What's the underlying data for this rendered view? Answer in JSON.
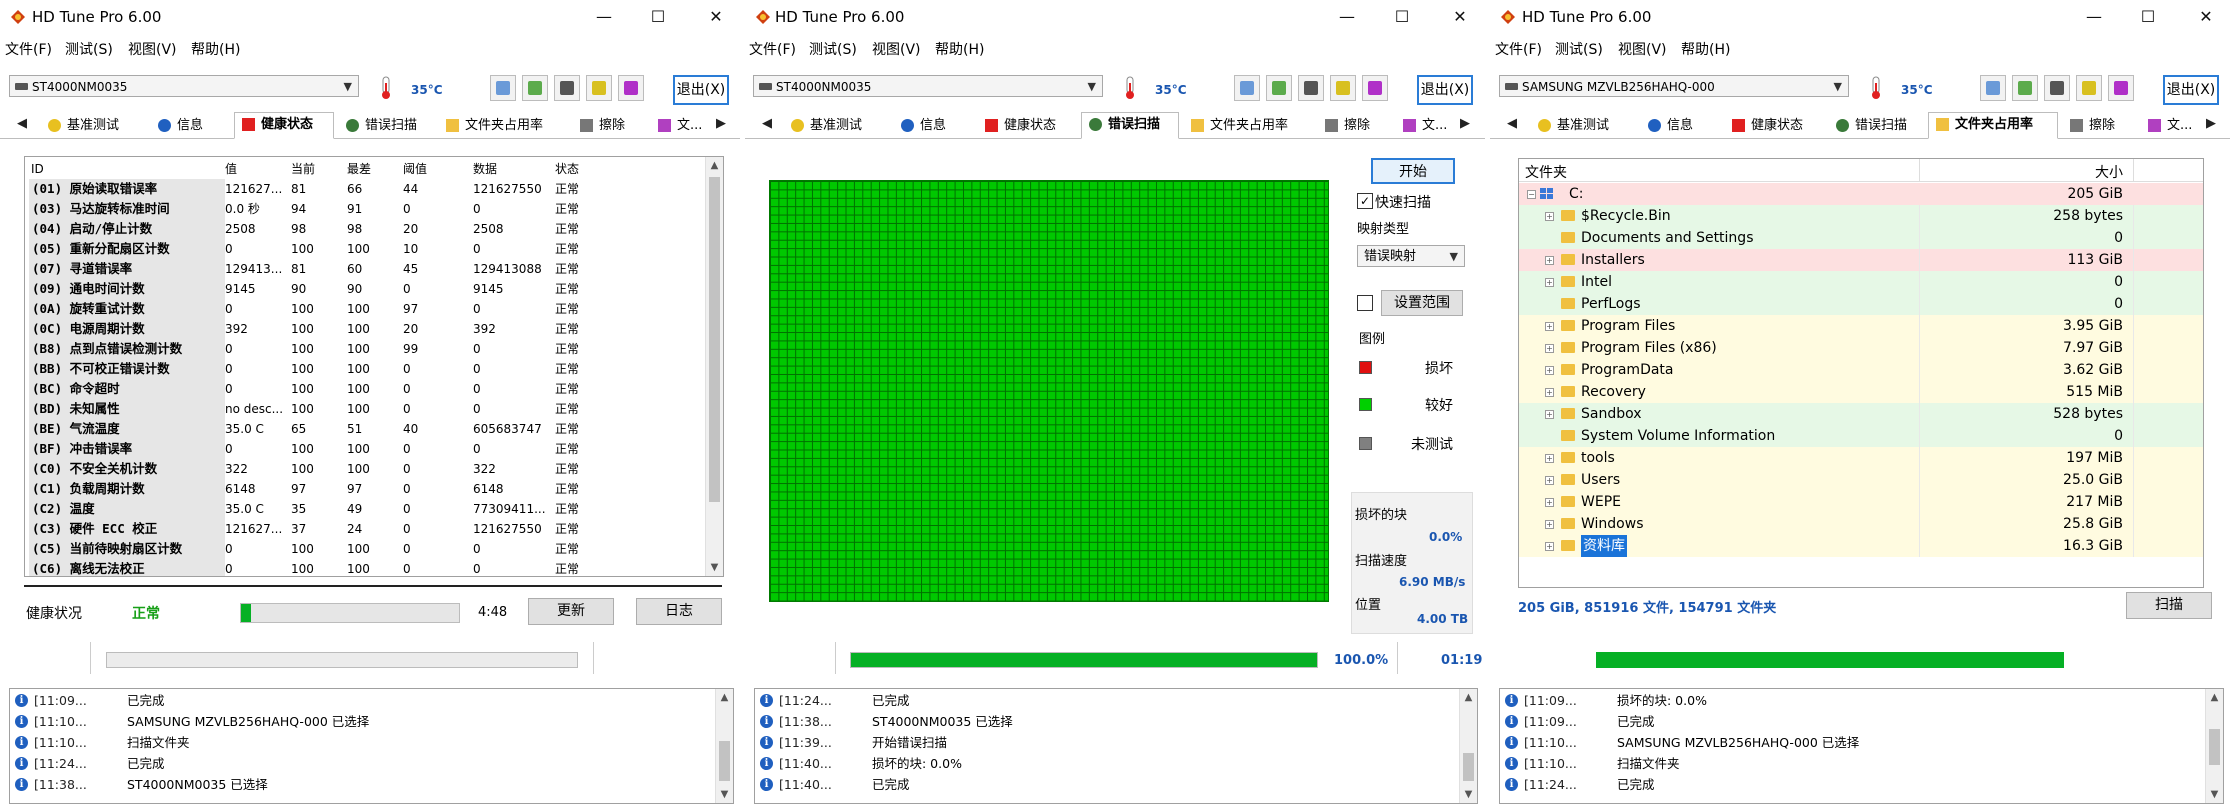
{
  "app": {
    "title": "HD Tune Pro 6.00",
    "exit_label": "退出(X)",
    "temp": "35°C"
  },
  "menu": [
    "文件(F)",
    "测试(S)",
    "视图(V)",
    "帮助(H)"
  ],
  "tabs": [
    "基准测试",
    "信息",
    "健康状态",
    "错误扫描",
    "文件夹占用率",
    "擦除",
    "文..."
  ],
  "win1": {
    "drive": "ST4000NM0035",
    "columns": [
      "ID",
      "值",
      "当前",
      "最差",
      "阈值",
      "数据",
      "状态"
    ],
    "rows": [
      [
        "(01) 原始读取错误率",
        "121627...",
        "81",
        "66",
        "44",
        "121627550",
        "正常"
      ],
      [
        "(03) 马达旋转标准时间",
        "0.0 秒",
        "94",
        "91",
        "0",
        "0",
        "正常"
      ],
      [
        "(04) 启动/停止计数",
        "2508",
        "98",
        "98",
        "20",
        "2508",
        "正常"
      ],
      [
        "(05) 重新分配扇区计数",
        "0",
        "100",
        "100",
        "10",
        "0",
        "正常"
      ],
      [
        "(07) 寻道错误率",
        "129413...",
        "81",
        "60",
        "45",
        "129413088",
        "正常"
      ],
      [
        "(09) 通电时间计数",
        "9145",
        "90",
        "90",
        "0",
        "9145",
        "正常"
      ],
      [
        "(0A) 旋转重试计数",
        "0",
        "100",
        "100",
        "97",
        "0",
        "正常"
      ],
      [
        "(0C) 电源周期计数",
        "392",
        "100",
        "100",
        "20",
        "392",
        "正常"
      ],
      [
        "(B8) 点到点错误检测计数",
        "0",
        "100",
        "100",
        "99",
        "0",
        "正常"
      ],
      [
        "(BB) 不可校正错误计数",
        "0",
        "100",
        "100",
        "0",
        "0",
        "正常"
      ],
      [
        "(BC) 命令超时",
        "0",
        "100",
        "100",
        "0",
        "0",
        "正常"
      ],
      [
        "(BD) 未知属性",
        "no desc...",
        "100",
        "100",
        "0",
        "0",
        "正常"
      ],
      [
        "(BE) 气流温度",
        "35.0 C",
        "65",
        "51",
        "40",
        "605683747",
        "正常"
      ],
      [
        "(BF) 冲击错误率",
        "0",
        "100",
        "100",
        "0",
        "0",
        "正常"
      ],
      [
        "(C0) 不安全关机计数",
        "322",
        "100",
        "100",
        "0",
        "322",
        "正常"
      ],
      [
        "(C1) 负载周期计数",
        "6148",
        "97",
        "97",
        "0",
        "6148",
        "正常"
      ],
      [
        "(C2) 温度",
        "35.0 C",
        "35",
        "49",
        "0",
        "77309411...",
        "正常"
      ],
      [
        "(C3) 硬件 ECC 校正",
        "121627...",
        "37",
        "24",
        "0",
        "121627550",
        "正常"
      ],
      [
        "(C5) 当前待映射扇区计数",
        "0",
        "100",
        "100",
        "0",
        "0",
        "正常"
      ],
      [
        "(C6) 离线无法校正",
        "0",
        "100",
        "100",
        "0",
        "0",
        "正常"
      ]
    ],
    "health_label": "健康状况",
    "health_value": "正常",
    "time": "4:48",
    "update_label": "更新",
    "log_label": "日志",
    "log": [
      [
        "[11:09...",
        "已完成"
      ],
      [
        "[11:10...",
        "SAMSUNG MZVLB256HAHQ-000 已选择"
      ],
      [
        "[11:10...",
        "扫描文件夹"
      ],
      [
        "[11:24...",
        "已完成"
      ],
      [
        "[11:38...",
        "ST4000NM0035 已选择"
      ]
    ]
  },
  "win2": {
    "drive": "ST4000NM0035",
    "start_label": "开始",
    "quick_scan_label": "快速扫描",
    "map_type_label": "映射类型",
    "map_type_value": "错误映射",
    "range_label": "设置范围",
    "legend_title": "图例",
    "legend": [
      {
        "label": "损坏",
        "color": "#e01010"
      },
      {
        "label": "较好",
        "color": "#00d000"
      },
      {
        "label": "未测试",
        "color": "#808080"
      }
    ],
    "bad_blocks_label": "损坏的块",
    "bad_blocks_value": "0.0%",
    "speed_label": "扫描速度",
    "speed_value": "6.90 MB/s",
    "position_label": "位置",
    "position_value": "4.00 TB",
    "progress": 1.0,
    "progress_text": "100.0%",
    "elapsed": "01:19",
    "log": [
      [
        "[11:24...",
        "已完成"
      ],
      [
        "[11:38...",
        "ST4000NM0035 已选择"
      ],
      [
        "[11:39...",
        "开始错误扫描"
      ],
      [
        "[11:40...",
        "损坏的块: 0.0%"
      ],
      [
        "[11:40...",
        "已完成"
      ]
    ]
  },
  "win3": {
    "drive": "SAMSUNG MZVLB256HAHQ-000",
    "col_folder": "文件夹",
    "col_size": "大小",
    "root": {
      "name": "C:",
      "size": "205 GiB"
    },
    "folders": [
      {
        "name": "$Recycle.Bin",
        "size": "258 bytes",
        "bg": "#e6f8e6",
        "expandable": true
      },
      {
        "name": "Documents and Settings",
        "size": "0",
        "bg": "#e6f8e6",
        "expandable": false
      },
      {
        "name": "Installers",
        "size": "113 GiB",
        "bg": "#fde0e0",
        "expandable": true
      },
      {
        "name": "Intel",
        "size": "0",
        "bg": "#e6f8e6",
        "expandable": true
      },
      {
        "name": "PerfLogs",
        "size": "0",
        "bg": "#e6f8e6",
        "expandable": false
      },
      {
        "name": "Program Files",
        "size": "3.95 GiB",
        "bg": "#fffbe0",
        "expandable": true
      },
      {
        "name": "Program Files (x86)",
        "size": "7.97 GiB",
        "bg": "#fffbe0",
        "expandable": true
      },
      {
        "name": "ProgramData",
        "size": "3.62 GiB",
        "bg": "#fffbe0",
        "expandable": true
      },
      {
        "name": "Recovery",
        "size": "515 MiB",
        "bg": "#fffbe0",
        "expandable": true
      },
      {
        "name": "Sandbox",
        "size": "528 bytes",
        "bg": "#e6f8e6",
        "expandable": true
      },
      {
        "name": "System Volume Information",
        "size": "0",
        "bg": "#e6f8e6",
        "expandable": false
      },
      {
        "name": "tools",
        "size": "197 MiB",
        "bg": "#fffbe0",
        "expandable": true
      },
      {
        "name": "Users",
        "size": "25.0 GiB",
        "bg": "#fffbe0",
        "expandable": true
      },
      {
        "name": "WEPE",
        "size": "217 MiB",
        "bg": "#fffbe0",
        "expandable": true
      },
      {
        "name": "Windows",
        "size": "25.8 GiB",
        "bg": "#fffbe0",
        "expandable": true
      },
      {
        "name": "资料库",
        "size": "16.3 GiB",
        "bg": "#fffbe0",
        "expandable": true,
        "selected": true
      }
    ],
    "summary": "205 GiB, 851916 文件, 154791 文件夹",
    "scan_label": "扫描",
    "progress": 0.935,
    "log": [
      [
        "[11:09...",
        "损坏的块: 0.0%"
      ],
      [
        "[11:09...",
        "已完成"
      ],
      [
        "[11:10...",
        "SAMSUNG MZVLB256HAHQ-000 已选择"
      ],
      [
        "[11:10...",
        "扫描文件夹"
      ],
      [
        "[11:24...",
        "已完成"
      ]
    ]
  }
}
